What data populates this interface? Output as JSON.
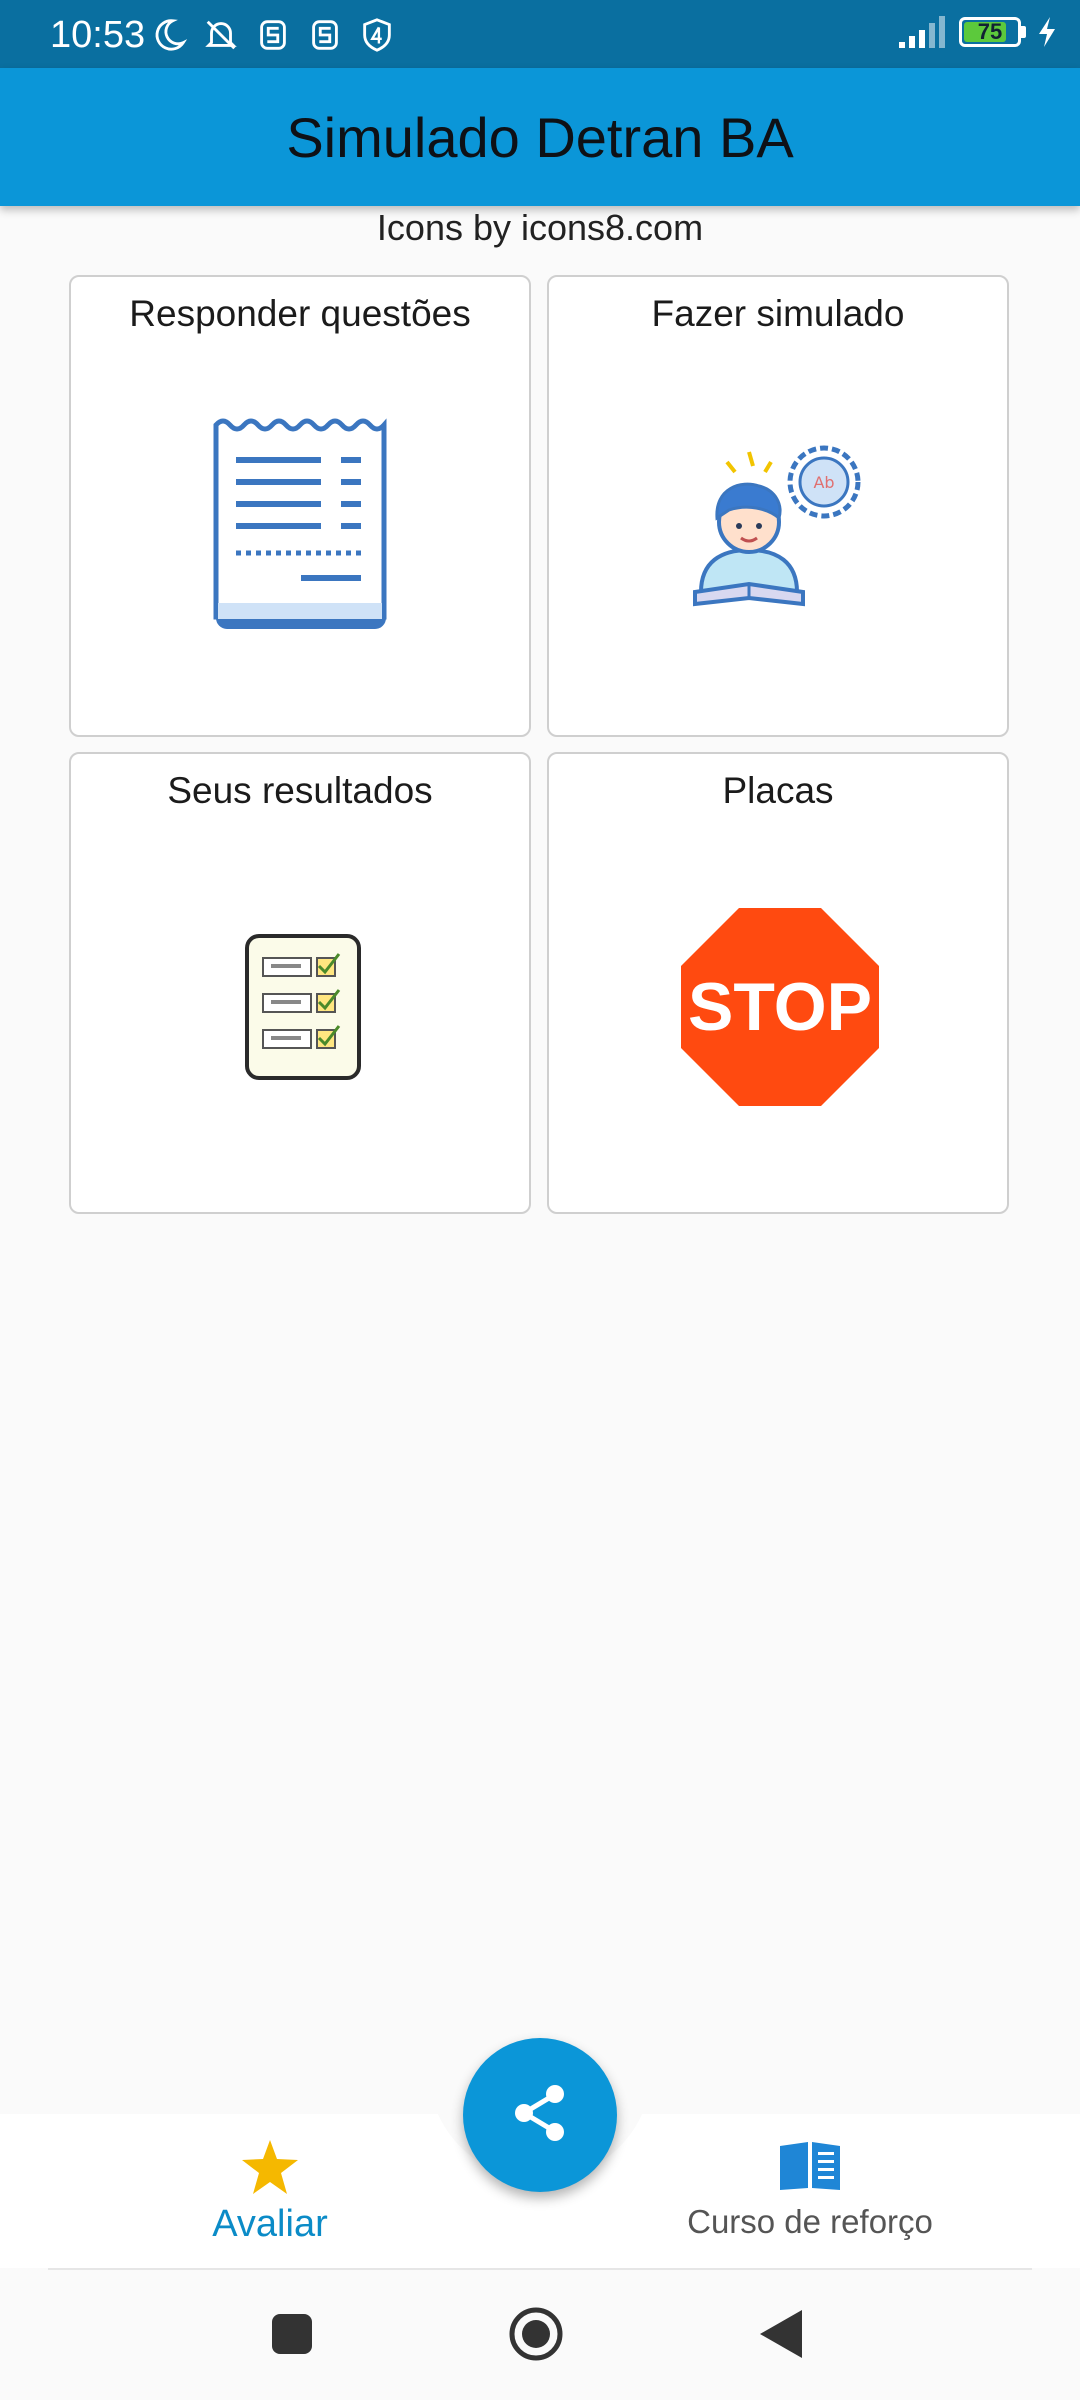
{
  "status_bar": {
    "time": "10:53",
    "battery_level": "75",
    "icons": [
      "moon-icon",
      "bell-off-icon",
      "s-app-icon",
      "s-app-icon",
      "shield-4-icon"
    ]
  },
  "app_bar": {
    "title": "Simulado Detran BA"
  },
  "credit": {
    "text": "Icons by icons8.com"
  },
  "cards": {
    "responder": {
      "label": "Responder questões",
      "icon": "receipt-icon"
    },
    "simulado": {
      "label": "Fazer simulado",
      "icon": "student-icon"
    },
    "resultados": {
      "label": "Seus resultados",
      "icon": "checklist-icon"
    },
    "placas": {
      "label": "Placas",
      "icon": "stop-sign-icon",
      "sign_text": "STOP"
    }
  },
  "bottom_nav": {
    "avaliar": {
      "label": "Avaliar",
      "icon": "star-icon"
    },
    "curso": {
      "label": "Curso de reforço",
      "icon": "book-icon"
    },
    "fab": {
      "icon": "share-icon"
    }
  },
  "colors": {
    "app_bar": "#0b96d8",
    "status_bar": "#0a6fa0",
    "accent_active": "#0b8bc7",
    "star": "#f5b800",
    "stop_red": "#ff4a10"
  }
}
